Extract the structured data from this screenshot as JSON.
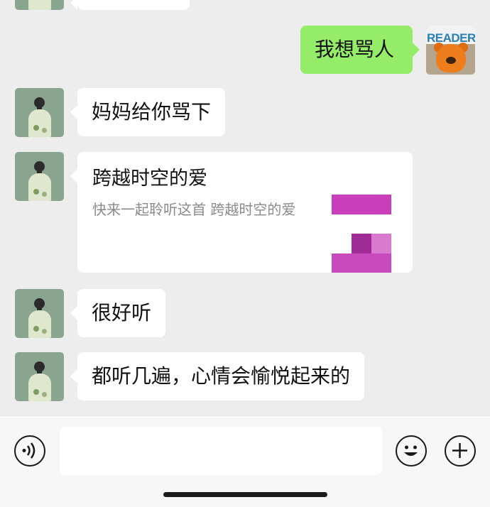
{
  "messages": [
    {
      "side": "right",
      "text": "我想骂人"
    },
    {
      "side": "left",
      "text": "妈妈给你骂下"
    },
    {
      "side": "left",
      "type": "card",
      "title": "跨越时空的爱",
      "description": "快来一起聆听这首 跨越时空的爱"
    },
    {
      "side": "left",
      "text": "很好听"
    },
    {
      "side": "left",
      "text": "都听几遍，心情会愉悦起来的"
    }
  ],
  "self_avatar": {
    "magazine_label": "READER"
  },
  "input_bar": {
    "voice_icon": "voice-icon",
    "input_value": "",
    "emoji_icon": "emoji-icon",
    "add_icon": "plus-icon"
  },
  "colors": {
    "background": "#ededed",
    "outgoing_bubble": "#95ec69",
    "incoming_bubble": "#ffffff",
    "thumb_magenta": "#c43fb7"
  }
}
